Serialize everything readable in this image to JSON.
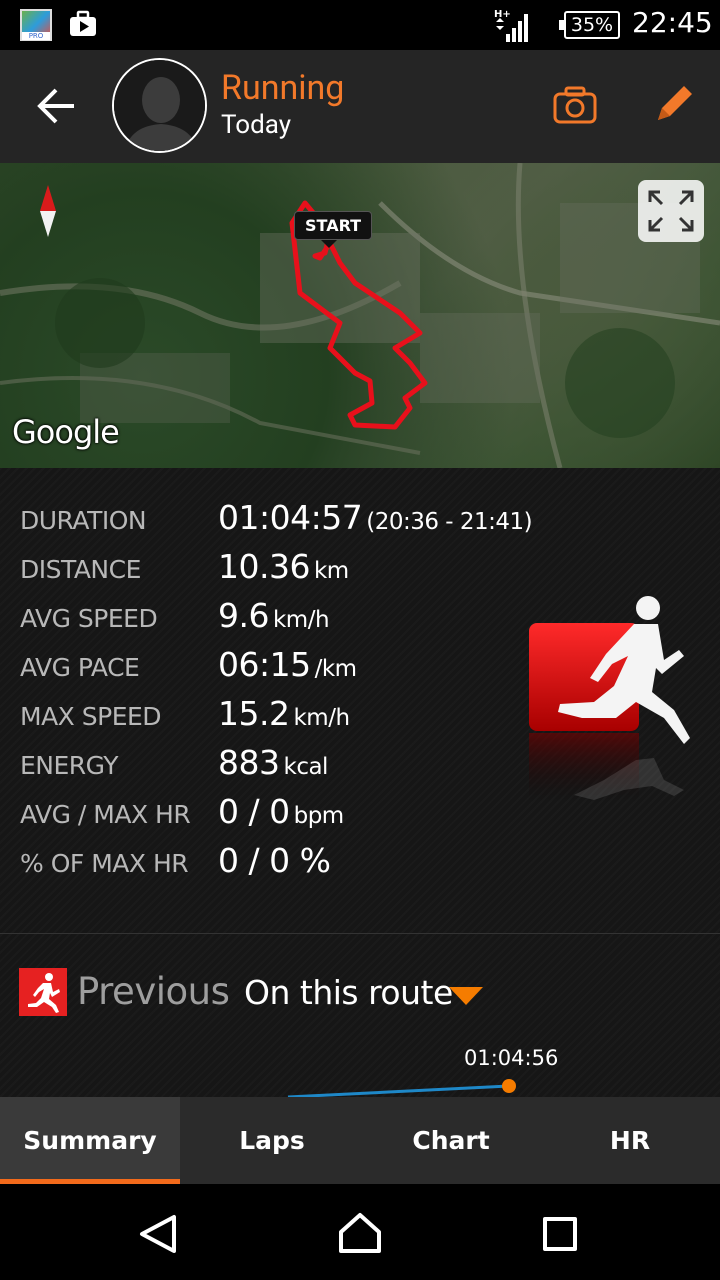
{
  "status_bar": {
    "app_badge": "PRO",
    "network": "H+",
    "battery": "35%",
    "time": "22:45"
  },
  "header": {
    "title": "Running",
    "subtitle": "Today"
  },
  "map": {
    "start_label": "START",
    "attribution": "Google"
  },
  "stats": [
    {
      "label": "DURATION",
      "value": "01:04:57",
      "unit": "(20:36 - 21:41)"
    },
    {
      "label": "DISTANCE",
      "value": "10.36",
      "unit": "km"
    },
    {
      "label": "AVG SPEED",
      "value": "9.6",
      "unit": "km/h"
    },
    {
      "label": "AVG PACE",
      "value": "06:15",
      "unit": "/km"
    },
    {
      "label": "MAX SPEED",
      "value": "15.2",
      "unit": "km/h"
    },
    {
      "label": "ENERGY",
      "value": "883",
      "unit": "kcal"
    },
    {
      "label": "AVG / MAX HR",
      "value": "0 / 0",
      "unit": "bpm"
    },
    {
      "label": "% OF MAX HR",
      "value": "0 / 0 %",
      "unit": ""
    }
  ],
  "previous": {
    "label": "Previous",
    "filter": "On this route",
    "chart_time": "01:04:56"
  },
  "tabs": [
    {
      "label": "Summary",
      "active": true
    },
    {
      "label": "Laps",
      "active": false
    },
    {
      "label": "Chart",
      "active": false
    },
    {
      "label": "HR",
      "active": false
    }
  ],
  "colors": {
    "accent": "#f2792a",
    "route": "#e8101b",
    "tab_indicator": "#f26a1b",
    "chart_line": "#1e88c8",
    "chart_point": "#f57c00"
  }
}
